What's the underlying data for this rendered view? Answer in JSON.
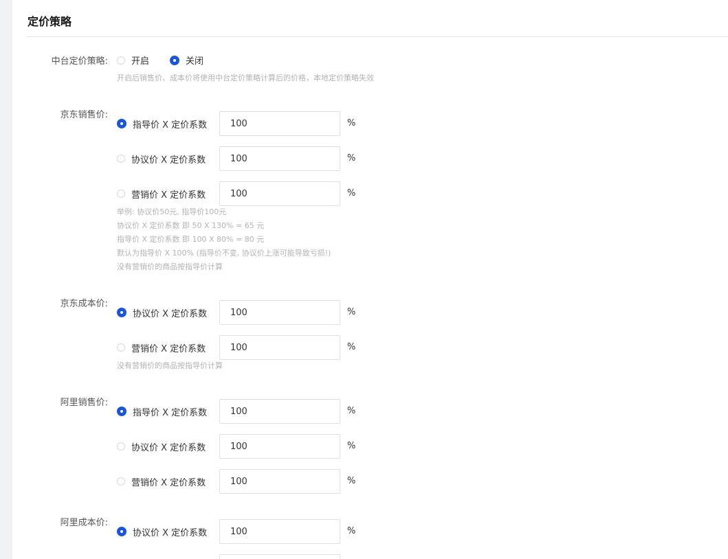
{
  "section_title": "定价策略",
  "middle_strategy": {
    "label": "中台定价策略:",
    "options": [
      "开启",
      "关闭"
    ],
    "selected": "关闭",
    "hint": "开启后销售价、成本价将使用中台定价策略计算后的价格，本地定价策略失效"
  },
  "jd_sale": {
    "label": "京东销售价:",
    "rows": [
      {
        "text": "指导价 X 定价系数",
        "value": "100",
        "unit": "%",
        "checked": true
      },
      {
        "text": "协议价 X 定价系数",
        "value": "100",
        "unit": "%",
        "checked": false
      },
      {
        "text": "营销价 X 定价系数",
        "value": "100",
        "unit": "%",
        "checked": false
      }
    ],
    "hints": [
      "举例: 协议价50元, 指导价100元",
      "协议价 X 定价系数 即 50 X 130% = 65 元",
      "指导价 X 定价系数 即 100 X 80% = 80 元",
      "默认为指导价 X 100% (指导价不变, 协议价上涨可能导致亏损!)",
      "没有营销价的商品按指导价计算"
    ]
  },
  "jd_cost": {
    "label": "京东成本价:",
    "rows": [
      {
        "text": "协议价 X 定价系数",
        "value": "100",
        "unit": "%",
        "checked": true
      },
      {
        "text": "营销价 X 定价系数",
        "value": "100",
        "unit": "%",
        "checked": false
      }
    ],
    "hints": [
      "没有营销价的商品按指导价计算"
    ]
  },
  "ali_sale": {
    "label": "阿里销售价:",
    "rows": [
      {
        "text": "指导价 X 定价系数",
        "value": "100",
        "unit": "%",
        "checked": true
      },
      {
        "text": "协议价 X 定价系数",
        "value": "100",
        "unit": "%",
        "checked": false
      },
      {
        "text": "营销价 X 定价系数",
        "value": "100",
        "unit": "%",
        "checked": false
      }
    ]
  },
  "ali_cost": {
    "label": "阿里成本价:",
    "rows": [
      {
        "text": "协议价 X 定价系数",
        "value": "100",
        "unit": "%",
        "checked": true
      }
    ]
  },
  "colors": {
    "primary": "#1a56db",
    "hint": "#b3b3b3",
    "divider": "#e4e6ea"
  }
}
